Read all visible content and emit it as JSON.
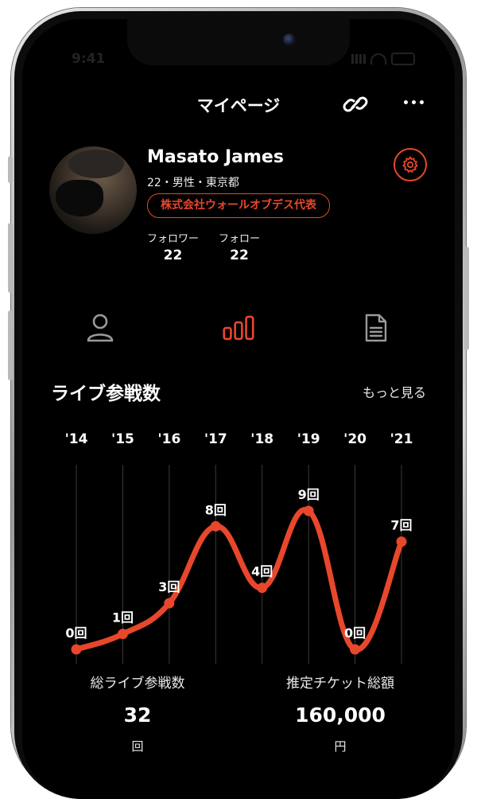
{
  "status_bar": {
    "time": "9:41"
  },
  "header": {
    "title": "マイページ",
    "link_icon": "link-icon",
    "more_icon": "more-icon"
  },
  "profile": {
    "name": "Masato James",
    "meta": "22・男性・東京都",
    "badge": "株式会社ウォールオブデス代表",
    "followers_label": "フォロワー",
    "followers_count": "22",
    "following_label": "フォロー",
    "following_count": "22"
  },
  "tabs": [
    {
      "icon": "person-icon",
      "active": false
    },
    {
      "icon": "bar-chart-icon",
      "active": true
    },
    {
      "icon": "document-icon",
      "active": false
    }
  ],
  "section": {
    "title": "ライブ参戦数",
    "more_label": "もっと見る"
  },
  "chart_data": {
    "type": "line",
    "categories": [
      "'14",
      "'15",
      "'16",
      "'17",
      "'18",
      "'19",
      "'20",
      "'21"
    ],
    "values": [
      0,
      1,
      3,
      8,
      4,
      9,
      0,
      7
    ],
    "value_labels": [
      "0回",
      "1回",
      "3回",
      "8回",
      "4回",
      "9回",
      "0回",
      "7回"
    ],
    "ylim": [
      0,
      9
    ],
    "grid": "vertical",
    "line_color": "#e8472c"
  },
  "stats": {
    "total_label": "総ライブ参戦数",
    "total_value": "32",
    "total_unit": "回",
    "ticket_label": "推定チケット総額",
    "ticket_value": "160,000",
    "ticket_unit": "円"
  },
  "colors": {
    "accent": "#e8472c",
    "background": "#000000",
    "text": "#ffffff"
  }
}
